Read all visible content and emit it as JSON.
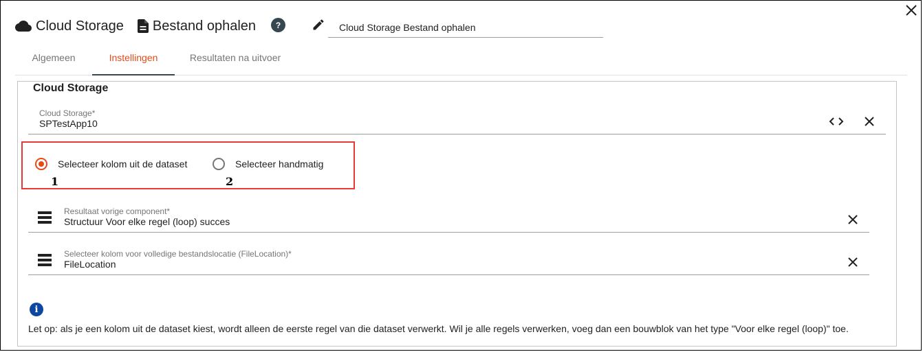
{
  "header": {
    "service_title": "Cloud Storage",
    "action_title": "Bestand ophalen",
    "help_label": "?",
    "name_value": "Cloud Storage Bestand ophalen"
  },
  "tabs": [
    {
      "label": "Algemeen",
      "active": false
    },
    {
      "label": "Instellingen",
      "active": true
    },
    {
      "label": "Resultaten na uitvoer",
      "active": false
    }
  ],
  "section": {
    "title": "Cloud Storage",
    "storage_field": {
      "label": "Cloud Storage*",
      "value": "SPTestApp10"
    },
    "radio_options": [
      {
        "label": "Selecteer kolom uit de dataset",
        "checked": true,
        "annotation": "1"
      },
      {
        "label": "Selecteer handmatig",
        "checked": false,
        "annotation": "2"
      }
    ],
    "previous_result": {
      "label": "Resultaat vorige component*",
      "value": "Structuur Voor elke regel (loop) succes"
    },
    "file_location": {
      "label": "Selecteer kolom voor volledige bestandslocatie (FileLocation)*",
      "value": "FileLocation"
    },
    "info_label": "i",
    "note": "Let op: als je een kolom uit de dataset kiest, wordt alleen de eerste regel van die dataset verwerkt. Wil je alle regels verwerken, voeg dan een bouwblok van het type \"Voor elke regel (loop)\" toe."
  },
  "colors": {
    "accent": "#e64a19",
    "highlight_box": "#e53935",
    "info": "#0d47a1",
    "help": "#37474f"
  }
}
